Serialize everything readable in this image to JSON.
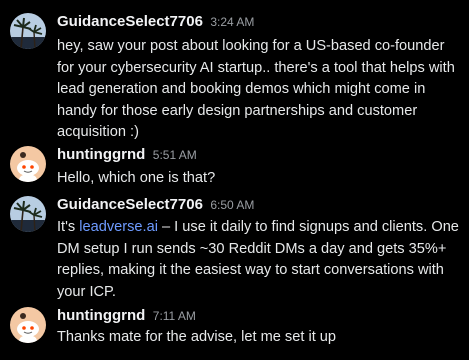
{
  "messages": [
    {
      "username": "GuidanceSelect7706",
      "time": "3:24 AM",
      "avatar": "palm-tree-photo-avatar",
      "text": "hey, saw your post about looking for a US-based co-founder for your cybersecurity AI startup.. there's a tool that helps with lead generation and booking demos which might come in handy for those early design partnerships and customer acquisition :)"
    },
    {
      "username": "huntinggrnd",
      "time": "5:51 AM",
      "avatar": "snoo-avatar",
      "text": "Hello, which one is that?"
    },
    {
      "username": "GuidanceSelect7706",
      "time": "6:50 AM",
      "avatar": "palm-tree-photo-avatar",
      "text_before": "It's ",
      "link_text": "leadverse.ai",
      "text_after": " – I use it daily to find signups and clients. One DM setup I run sends ~30 Reddit DMs a day and gets 35%+ replies, making it the easiest way to start conversations with your ICP."
    },
    {
      "username": "huntinggrnd",
      "time": "7:11 AM",
      "avatar": "snoo-avatar",
      "text": "Thanks mate for the advise, let me set it up"
    }
  ],
  "colors": {
    "background": "#000000",
    "text": "#e7e9ea",
    "timestamp": "#9a9ea3",
    "link": "#6e9bff"
  }
}
